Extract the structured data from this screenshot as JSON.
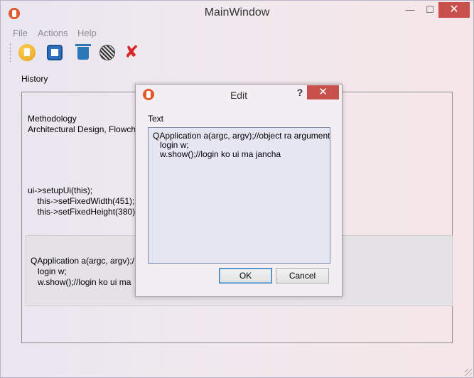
{
  "window": {
    "title": "MainWindow",
    "minimize": "—",
    "maximize": "☐",
    "close": "✕"
  },
  "menu": {
    "items": [
      "File",
      "Actions",
      "Help"
    ]
  },
  "toolbar": {
    "icons": [
      "new-note-icon",
      "edit-icon",
      "trash-icon",
      "clear-icon",
      "exit-icon"
    ],
    "exit_glyph": "✘"
  },
  "history": {
    "label": "History",
    "items": [
      "Methodology\nArchitectural Design, Flowch",
      "ui->setupUi(this);\n    this->setFixedWidth(451);\n    this->setFixedHeight(380);",
      "QApplication a(argc, argv);/\n   login w;\n   w.show();//login ko ui ma"
    ]
  },
  "dialog": {
    "title": "Edit",
    "help": "?",
    "close": "✕",
    "text_label": "Text",
    "text_value": "QApplication a(argc, argv);//object ra argument\n   login w;\n   w.show();//login ko ui ma jancha",
    "ok_label": "OK",
    "cancel_label": "Cancel"
  },
  "colors": {
    "close_button": "#c7514a",
    "app_icon": "#e2582b",
    "selected_item_bg": "#e5e2e6"
  }
}
